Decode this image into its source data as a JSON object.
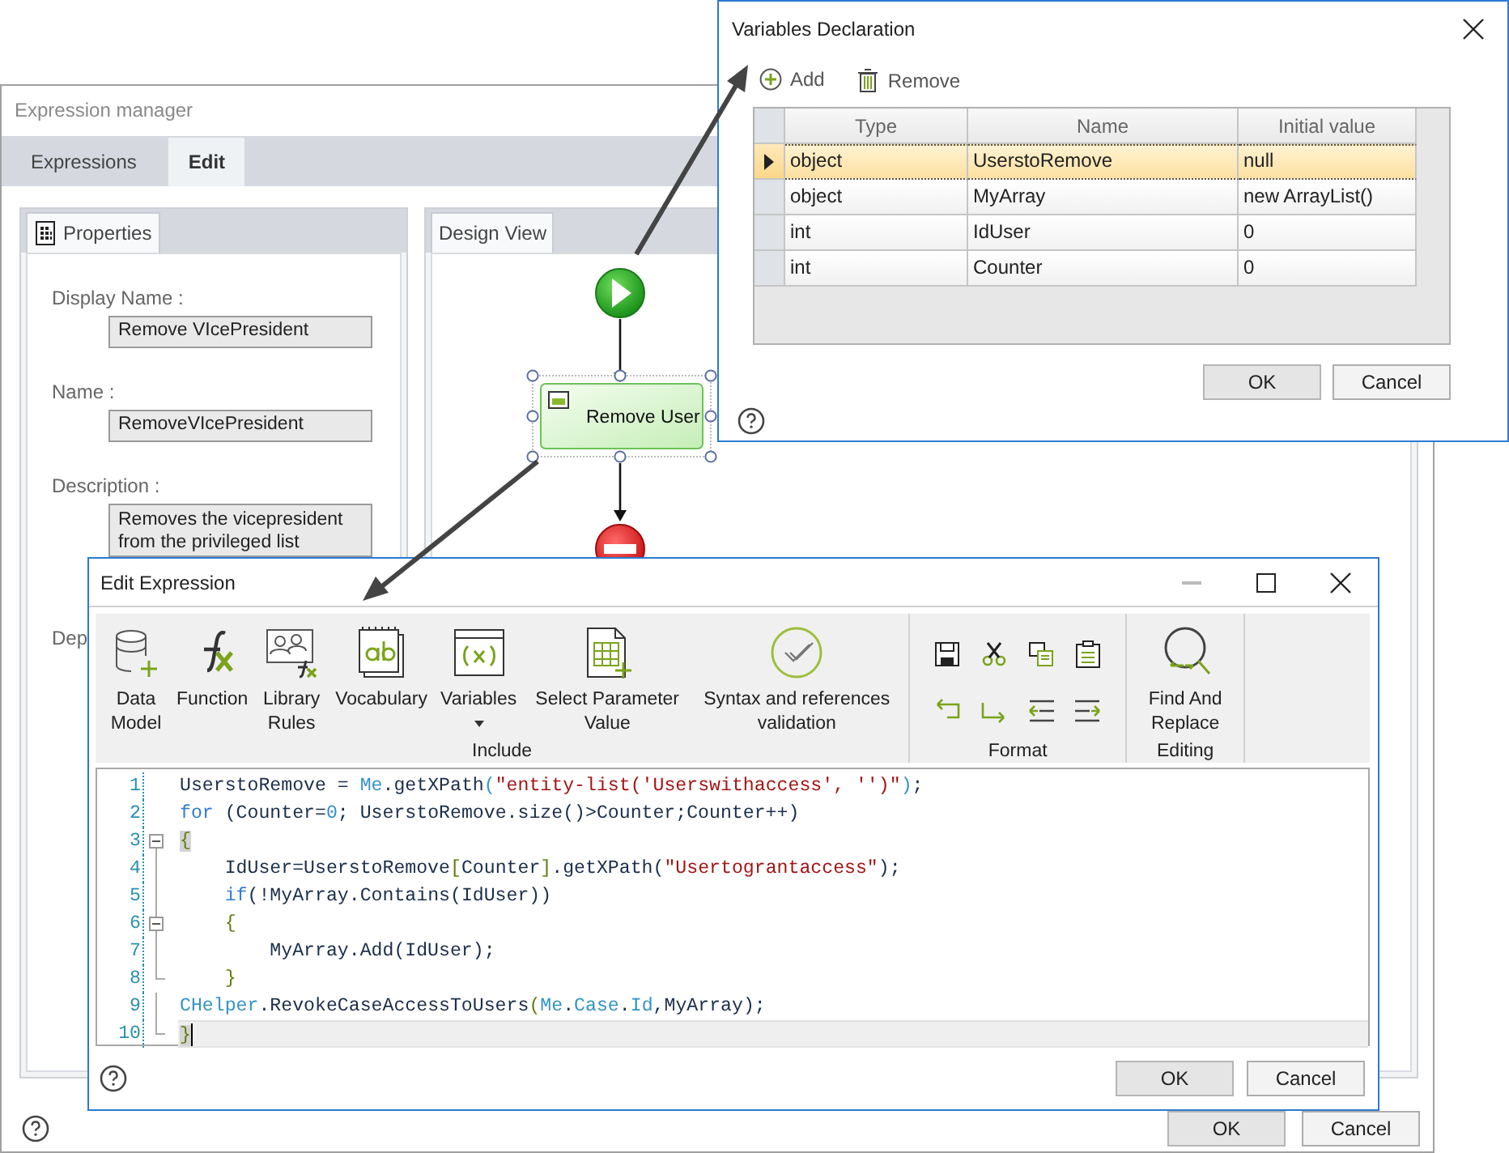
{
  "expression_manager": {
    "title": "Expression manager",
    "tabs": [
      {
        "label": "Expressions",
        "selected": false
      },
      {
        "label": "Edit",
        "selected": true
      }
    ],
    "properties": {
      "tab": "Properties",
      "fields": [
        {
          "kind": "text",
          "label": "Display Name :",
          "value": "Remove VIcePresident"
        },
        {
          "kind": "text",
          "label": "Name :",
          "value": "RemoveVIcePresident"
        },
        {
          "kind": "multiline",
          "label": "Description :",
          "value": "Removes the vicepresident from the privileged list"
        },
        {
          "kind": "label",
          "label": "Dep"
        }
      ]
    },
    "design_view": {
      "tab": "Design View",
      "nodes": [
        {
          "kind": "start"
        },
        {
          "kind": "task",
          "label": "Remove User",
          "selected": true
        },
        {
          "kind": "end"
        }
      ]
    },
    "buttons": [
      "OK",
      "Cancel"
    ]
  },
  "variables_dialog": {
    "title": "Variables Declaration",
    "toolbar": [
      {
        "kind": "add",
        "label": "Add"
      },
      {
        "kind": "remove",
        "label": "Remove"
      }
    ],
    "grid": {
      "columns": [
        "Type",
        "Name",
        "Initial value"
      ],
      "rows": [
        {
          "cells": [
            "object",
            "UserstoRemove",
            "null"
          ],
          "selected": true
        },
        {
          "cells": [
            "object",
            "MyArray",
            "new ArrayList()"
          ],
          "selected": false
        },
        {
          "cells": [
            "int",
            "IdUser",
            "0"
          ],
          "selected": false
        },
        {
          "cells": [
            "int",
            "Counter",
            "0"
          ],
          "selected": false
        }
      ]
    },
    "buttons": [
      "OK",
      "Cancel"
    ]
  },
  "edit_expression": {
    "title": "Edit Expression",
    "ribbon": {
      "groups": [
        {
          "label": "Include",
          "buttons": [
            {
              "kind": "data-model",
              "label": "Data Model"
            },
            {
              "kind": "function",
              "label": "Function"
            },
            {
              "kind": "library-rules",
              "label": "Library Rules"
            },
            {
              "kind": "vocabulary",
              "label": "Vocabulary"
            },
            {
              "kind": "variables",
              "label": "Variables",
              "dropdown": true
            },
            {
              "kind": "select-parameter",
              "label": "Select Parameter Value"
            },
            {
              "kind": "validation",
              "label": "Syntax and references validation"
            }
          ]
        },
        {
          "label": "Format",
          "tools": [
            {
              "kind": "save"
            },
            {
              "kind": "cut"
            },
            {
              "kind": "copy"
            },
            {
              "kind": "paste"
            },
            {
              "kind": "undo"
            },
            {
              "kind": "redo"
            },
            {
              "kind": "outdent"
            },
            {
              "kind": "indent"
            }
          ]
        },
        {
          "label": "Editing",
          "buttons": [
            {
              "kind": "find-replace",
              "label": "Find And Replace"
            }
          ]
        }
      ]
    },
    "code": {
      "lines": [
        {
          "number": "1",
          "current": false,
          "segments": [
            {
              "kind": "plain",
              "text": "UserstoRemove = "
            },
            {
              "kind": "member",
              "text": "Me"
            },
            {
              "kind": "plain",
              "text": ".getXPath"
            },
            {
              "kind": "member",
              "text": "("
            },
            {
              "kind": "string",
              "text": "\"entity-list('Userswithaccess', '')\""
            },
            {
              "kind": "member",
              "text": ")"
            },
            {
              "kind": "plain",
              "text": ";"
            }
          ]
        },
        {
          "number": "2",
          "current": false,
          "segments": [
            {
              "kind": "keyword",
              "text": "for"
            },
            {
              "kind": "plain",
              "text": " (Counter="
            },
            {
              "kind": "member",
              "text": "0"
            },
            {
              "kind": "plain",
              "text": "; UserstoRemove.size()>Counter;Counter++)"
            }
          ]
        },
        {
          "number": "3",
          "current": false,
          "expanded": true,
          "segments": [
            {
              "kind": "match",
              "text": "{"
            }
          ],
          "children": [
            {
              "number": "4",
              "current": false,
              "segments": [
                {
                  "kind": "plain",
                  "text": "    IdUser=UserstoRemove"
                },
                {
                  "kind": "punct",
                  "text": "["
                },
                {
                  "kind": "plain",
                  "text": "Counter"
                },
                {
                  "kind": "punct",
                  "text": "]"
                },
                {
                  "kind": "plain",
                  "text": ".getXPath("
                },
                {
                  "kind": "string",
                  "text": "\"Usertograntaccess\""
                },
                {
                  "kind": "plain",
                  "text": ");"
                }
              ]
            },
            {
              "number": "5",
              "current": false,
              "segments": [
                {
                  "kind": "keyword",
                  "text": "    if"
                },
                {
                  "kind": "plain",
                  "text": "(!MyArray.Contains(IdUser))"
                }
              ]
            },
            {
              "number": "6",
              "current": false,
              "expanded": true,
              "segments": [
                {
                  "kind": "punct",
                  "text": "    {"
                }
              ],
              "children": [
                {
                  "number": "7",
                  "current": false,
                  "segments": [
                    {
                      "kind": "plain",
                      "text": "        MyArray.Add(IdUser);"
                    }
                  ]
                },
                {
                  "number": "8",
                  "current": false,
                  "segments": [
                    {
                      "kind": "punct",
                      "text": "    }"
                    }
                  ]
                }
              ]
            },
            {
              "number": "9",
              "current": false,
              "segments": [
                {
                  "kind": "member",
                  "text": "CHelper"
                },
                {
                  "kind": "plain",
                  "text": ".RevokeCaseAccessToUsers"
                },
                {
                  "kind": "punct",
                  "text": "("
                },
                {
                  "kind": "member",
                  "text": "Me"
                },
                {
                  "kind": "plain",
                  "text": "."
                },
                {
                  "kind": "member",
                  "text": "Case"
                },
                {
                  "kind": "plain",
                  "text": "."
                },
                {
                  "kind": "member",
                  "text": "Id"
                },
                {
                  "kind": "plain",
                  "text": ",MyArray);"
                }
              ]
            },
            {
              "number": "10",
              "current": true,
              "segments": [
                {
                  "kind": "match",
                  "text": "}"
                }
              ]
            }
          ]
        }
      ]
    },
    "buttons": [
      "OK",
      "Cancel"
    ]
  }
}
